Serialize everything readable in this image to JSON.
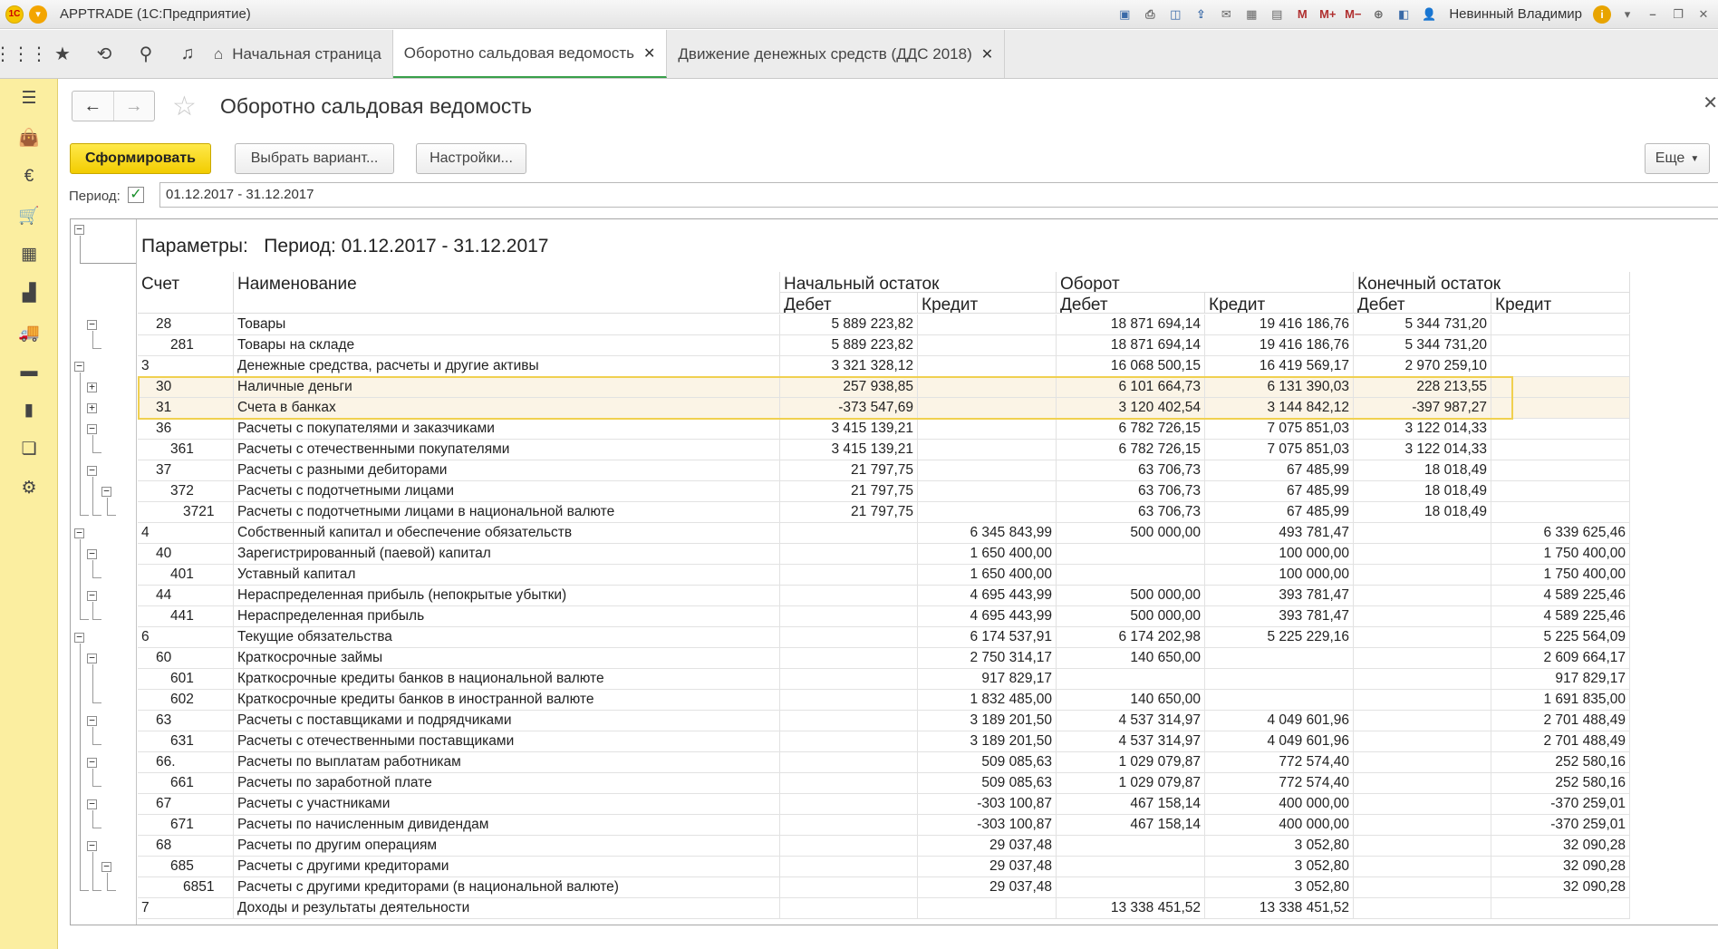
{
  "app": {
    "title": "APPTRADE (1С:Предприятие)",
    "user": "Невинный Владимир"
  },
  "tabs": [
    {
      "label": "Начальная страница"
    },
    {
      "label": "Оборотно сальдовая ведомость",
      "active": true
    },
    {
      "label": "Движение денежных средств (ДДС 2018)"
    }
  ],
  "form": {
    "title": "Оборотно сальдовая ведомость",
    "generate_label": "Сформировать",
    "variant_label": "Выбрать вариант...",
    "settings_label": "Настройки...",
    "more_label": "Еще",
    "period_label": "Период:",
    "period_value": "01.12.2017 - 31.12.2017",
    "period_dots": "..."
  },
  "report": {
    "params_label": "Параметры:",
    "params_value": "Период: 01.12.2017 - 31.12.2017",
    "headers": {
      "account": "Счет",
      "name": "Наименование",
      "opening": "Начальный остаток",
      "turnover": "Оборот",
      "closing": "Конечный остаток",
      "debit": "Дебет",
      "credit": "Кредит"
    },
    "rows": [
      {
        "acc": "28",
        "indent": 1,
        "name": "Товары",
        "od": "5 889 223,82",
        "oc": "",
        "td": "18 871 694,14",
        "tc": "19 416 186,76",
        "cd": "5 344 731,20",
        "cc": ""
      },
      {
        "acc": "281",
        "indent": 2,
        "name": "Товары на складе",
        "od": "5 889 223,82",
        "oc": "",
        "td": "18 871 694,14",
        "tc": "19 416 186,76",
        "cd": "5 344 731,20",
        "cc": ""
      },
      {
        "acc": "3",
        "indent": 0,
        "name": "Денежные средства, расчеты и другие активы",
        "od": "3 321 328,12",
        "oc": "",
        "td": "16 068 500,15",
        "tc": "16 419 569,17",
        "cd": "2 970 259,10",
        "cc": ""
      },
      {
        "acc": "30",
        "indent": 1,
        "name": "Наличные деньги",
        "od": "257 938,85",
        "oc": "",
        "td": "6 101 664,73",
        "tc": "6 131 390,03",
        "cd": "228 213,55",
        "cc": "",
        "hl": true
      },
      {
        "acc": "31",
        "indent": 1,
        "name": "Счета в банках",
        "od": "-373 547,69",
        "oc": "",
        "td": "3 120 402,54",
        "tc": "3 144 842,12",
        "cd": "-397 987,27",
        "cc": "",
        "hl": true
      },
      {
        "acc": "36",
        "indent": 1,
        "name": "Расчеты с покупателями и заказчиками",
        "od": "3 415 139,21",
        "oc": "",
        "td": "6 782 726,15",
        "tc": "7 075 851,03",
        "cd": "3 122 014,33",
        "cc": ""
      },
      {
        "acc": "361",
        "indent": 2,
        "name": "Расчеты с отечественными покупателями",
        "od": "3 415 139,21",
        "oc": "",
        "td": "6 782 726,15",
        "tc": "7 075 851,03",
        "cd": "3 122 014,33",
        "cc": ""
      },
      {
        "acc": "37",
        "indent": 1,
        "name": "Расчеты с разными дебиторами",
        "od": "21 797,75",
        "oc": "",
        "td": "63 706,73",
        "tc": "67 485,99",
        "cd": "18 018,49",
        "cc": ""
      },
      {
        "acc": "372",
        "indent": 2,
        "name": "Расчеты с подотчетными лицами",
        "od": "21 797,75",
        "oc": "",
        "td": "63 706,73",
        "tc": "67 485,99",
        "cd": "18 018,49",
        "cc": ""
      },
      {
        "acc": "3721",
        "indent": 3,
        "name": "Расчеты с подотчетными лицами в национальной валюте",
        "od": "21 797,75",
        "oc": "",
        "td": "63 706,73",
        "tc": "67 485,99",
        "cd": "18 018,49",
        "cc": ""
      },
      {
        "acc": "4",
        "indent": 0,
        "name": "Собственный капитал и обеспечение обязательств",
        "od": "",
        "oc": "6 345 843,99",
        "td": "500 000,00",
        "tc": "493 781,47",
        "cd": "",
        "cc": "6 339 625,46"
      },
      {
        "acc": "40",
        "indent": 1,
        "name": "Зарегистрированный (паевой) капитал",
        "od": "",
        "oc": "1 650 400,00",
        "td": "",
        "tc": "100 000,00",
        "cd": "",
        "cc": "1 750 400,00"
      },
      {
        "acc": "401",
        "indent": 2,
        "name": "Уставный капитал",
        "od": "",
        "oc": "1 650 400,00",
        "td": "",
        "tc": "100 000,00",
        "cd": "",
        "cc": "1 750 400,00"
      },
      {
        "acc": "44",
        "indent": 1,
        "name": "Нераспределенная прибыль (непокрытые убытки)",
        "od": "",
        "oc": "4 695 443,99",
        "td": "500 000,00",
        "tc": "393 781,47",
        "cd": "",
        "cc": "4 589 225,46"
      },
      {
        "acc": "441",
        "indent": 2,
        "name": "Нераспределенная прибыль",
        "od": "",
        "oc": "4 695 443,99",
        "td": "500 000,00",
        "tc": "393 781,47",
        "cd": "",
        "cc": "4 589 225,46"
      },
      {
        "acc": "6",
        "indent": 0,
        "name": "Текущие обязательства",
        "od": "",
        "oc": "6 174 537,91",
        "td": "6 174 202,98",
        "tc": "5 225 229,16",
        "cd": "",
        "cc": "5 225 564,09"
      },
      {
        "acc": "60",
        "indent": 1,
        "name": "Краткосрочные займы",
        "od": "",
        "oc": "2 750 314,17",
        "td": "140 650,00",
        "tc": "",
        "cd": "",
        "cc": "2 609 664,17"
      },
      {
        "acc": "601",
        "indent": 2,
        "name": "Краткосрочные кредиты банков в национальной валюте",
        "od": "",
        "oc": "917 829,17",
        "td": "",
        "tc": "",
        "cd": "",
        "cc": "917 829,17"
      },
      {
        "acc": "602",
        "indent": 2,
        "name": "Краткосрочные кредиты банков в иностранной валюте",
        "od": "",
        "oc": "1 832 485,00",
        "td": "140 650,00",
        "tc": "",
        "cd": "",
        "cc": "1 691 835,00"
      },
      {
        "acc": "63",
        "indent": 1,
        "name": "Расчеты с поставщиками и подрядчиками",
        "od": "",
        "oc": "3 189 201,50",
        "td": "4 537 314,97",
        "tc": "4 049 601,96",
        "cd": "",
        "cc": "2 701 488,49"
      },
      {
        "acc": "631",
        "indent": 2,
        "name": "Расчеты с отечественными поставщиками",
        "od": "",
        "oc": "3 189 201,50",
        "td": "4 537 314,97",
        "tc": "4 049 601,96",
        "cd": "",
        "cc": "2 701 488,49"
      },
      {
        "acc": "66.",
        "indent": 1,
        "name": "Расчеты по выплатам работникам",
        "od": "",
        "oc": "509 085,63",
        "td": "1 029 079,87",
        "tc": "772 574,40",
        "cd": "",
        "cc": "252 580,16"
      },
      {
        "acc": "661",
        "indent": 2,
        "name": "Расчеты по заработной плате",
        "od": "",
        "oc": "509 085,63",
        "td": "1 029 079,87",
        "tc": "772 574,40",
        "cd": "",
        "cc": "252 580,16"
      },
      {
        "acc": "67",
        "indent": 1,
        "name": "Расчеты с участниками",
        "od": "",
        "oc": "-303 100,87",
        "td": "467 158,14",
        "tc": "400 000,00",
        "cd": "",
        "cc": "-370 259,01"
      },
      {
        "acc": "671",
        "indent": 2,
        "name": "Расчеты по начисленным дивидендам",
        "od": "",
        "oc": "-303 100,87",
        "td": "467 158,14",
        "tc": "400 000,00",
        "cd": "",
        "cc": "-370 259,01"
      },
      {
        "acc": "68",
        "indent": 1,
        "name": "Расчеты по другим операциям",
        "od": "",
        "oc": "29 037,48",
        "td": "",
        "tc": "3 052,80",
        "cd": "",
        "cc": "32 090,28"
      },
      {
        "acc": "685",
        "indent": 2,
        "name": "Расчеты с другими кредиторами",
        "od": "",
        "oc": "29 037,48",
        "td": "",
        "tc": "3 052,80",
        "cd": "",
        "cc": "32 090,28"
      },
      {
        "acc": "6851",
        "indent": 3,
        "name": "Расчеты с другими кредиторами (в национальной валюте)",
        "od": "",
        "oc": "29 037,48",
        "td": "",
        "tc": "3 052,80",
        "cd": "",
        "cc": "32 090,28"
      },
      {
        "acc": "7",
        "indent": 0,
        "name": "Доходы и результаты деятельности",
        "od": "",
        "oc": "",
        "td": "13 338 451,52",
        "tc": "13 338 451,52",
        "cd": "",
        "cc": ""
      }
    ]
  }
}
